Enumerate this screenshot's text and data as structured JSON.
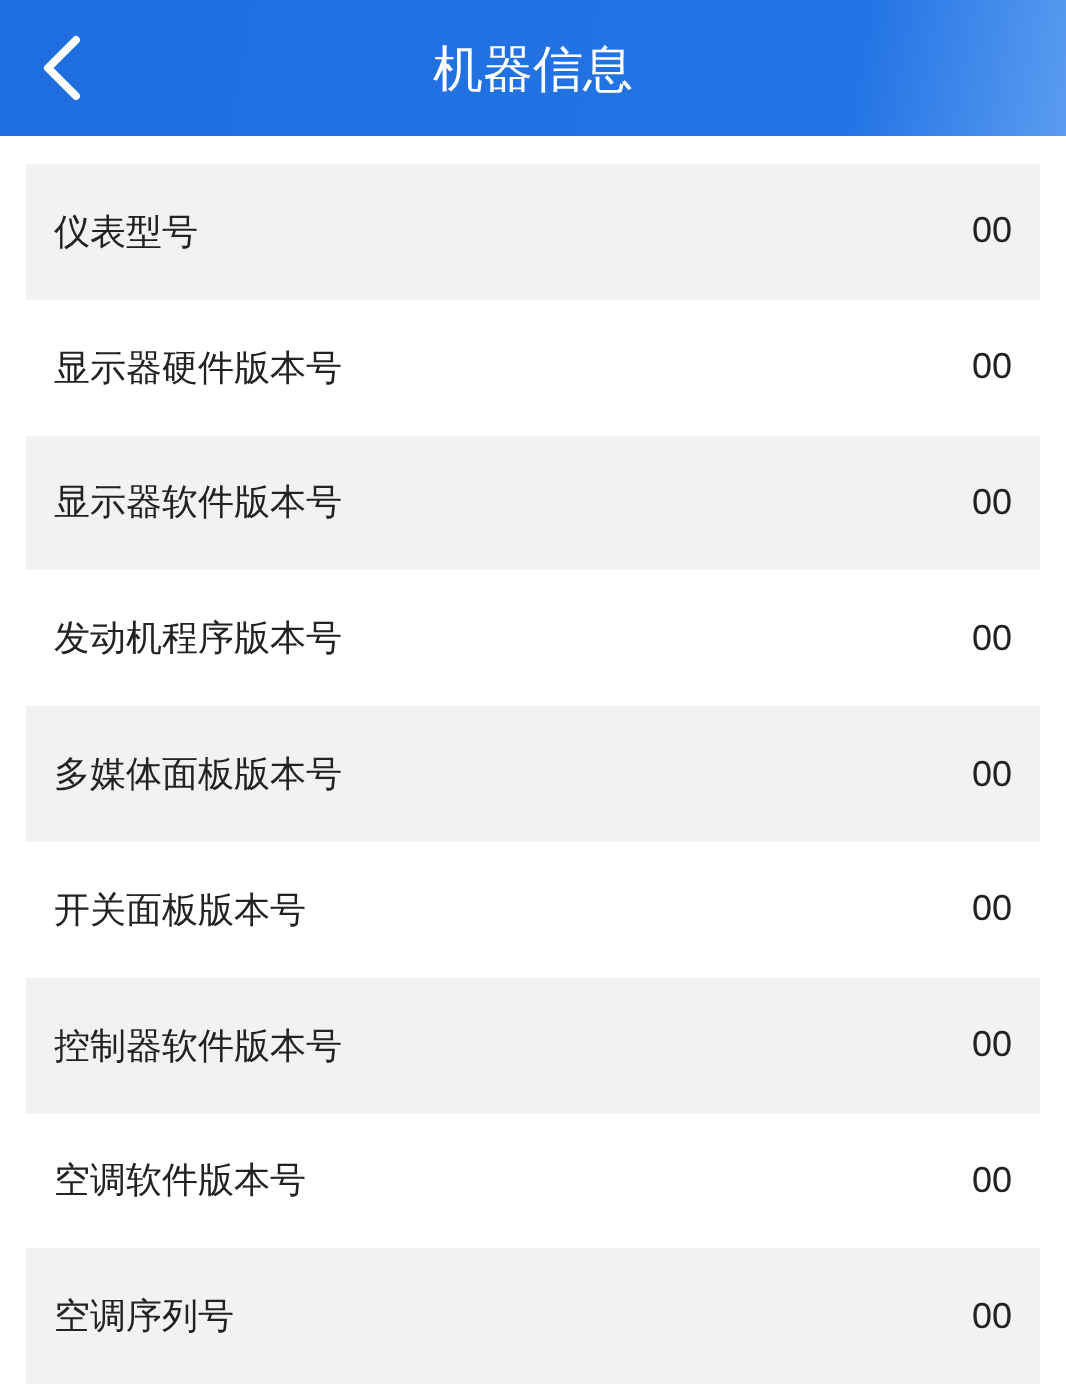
{
  "header": {
    "title": "机器信息"
  },
  "rows": [
    {
      "label": "仪表型号",
      "value": "00"
    },
    {
      "label": "显示器硬件版本号",
      "value": "00"
    },
    {
      "label": "显示器软件版本号",
      "value": "00"
    },
    {
      "label": "发动机程序版本号",
      "value": "00"
    },
    {
      "label": "多媒体面板版本号",
      "value": "00"
    },
    {
      "label": "开关面板版本号",
      "value": "00"
    },
    {
      "label": "控制器软件版本号",
      "value": "00"
    },
    {
      "label": "空调软件版本号",
      "value": "00"
    },
    {
      "label": "空调序列号",
      "value": "00"
    }
  ]
}
